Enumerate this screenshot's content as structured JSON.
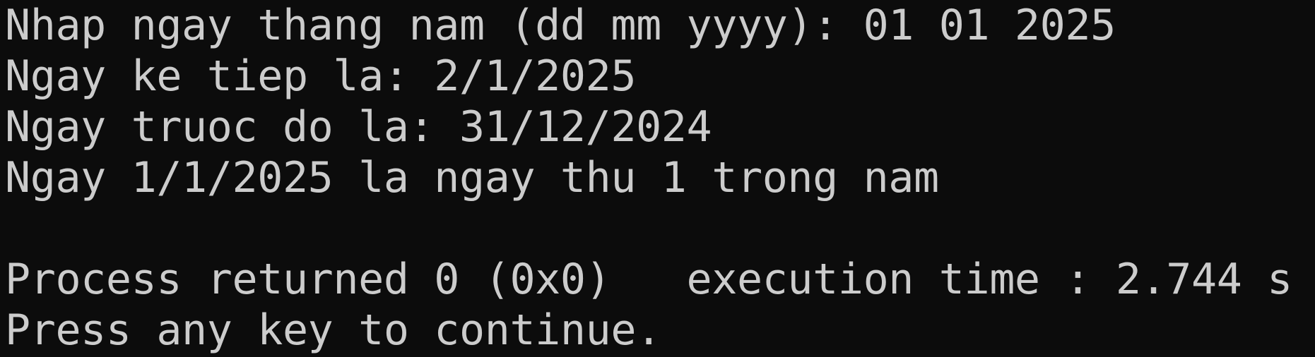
{
  "console": {
    "background": "#0c0c0c",
    "foreground": "#cccccc",
    "lines": [
      "Nhap ngay thang nam (dd mm yyyy): 01 01 2025",
      "Ngay ke tiep la: 2/1/2025",
      "Ngay truoc do la: 31/12/2024",
      "Ngay 1/1/2025 la ngay thu 1 trong nam",
      "",
      "Process returned 0 (0x0)   execution time : 2.744 s",
      "Press any key to continue."
    ]
  }
}
